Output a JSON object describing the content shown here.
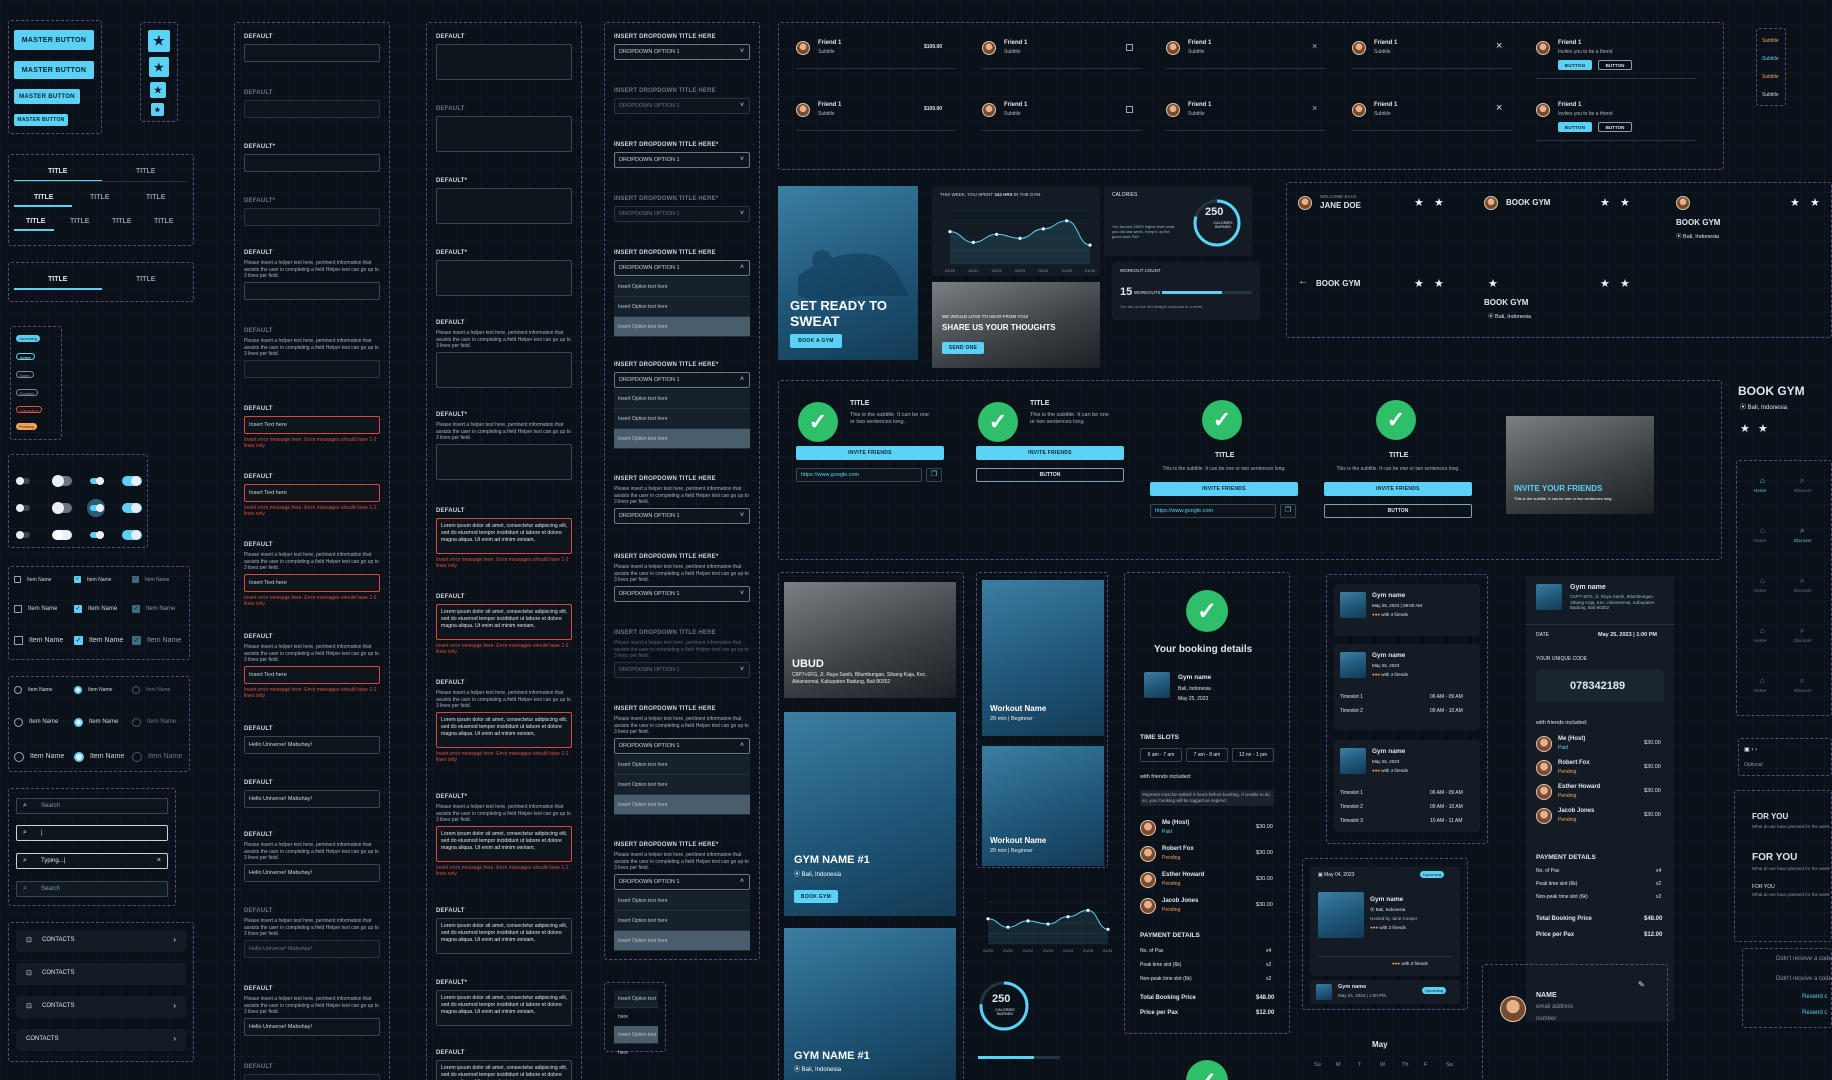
{
  "buttons": {
    "master": "MASTER BUTTON"
  },
  "tabs": {
    "active": "TITLE",
    "inactive": "TITLE"
  },
  "badges": [
    "Upcoming",
    "Active",
    "Done",
    "Expired",
    "Cancelled",
    "Pending"
  ],
  "item_name": "Item Name",
  "search": {
    "placeholder": "Search",
    "typing": "Typing...|",
    "cursor": "|"
  },
  "contacts": "CONTACTS",
  "forms": {
    "default": "DEFAULT",
    "default_req": "DEFAULT*",
    "helper": "Please insert a helper text here, pertinent information that assists the user in completing a field Helper text can go up to 3 lines per field.",
    "insert_text": "Insert Text here",
    "error": "Insert error message here. Error messages should have 1-2 lines only",
    "hello": "Hello Universe! Mabuhay!",
    "lorem": "Lorem ipsum dolor sit amet, consectetur adipiscing elit, sed do eiusmod tempor incididunt ut labore et dolore magna aliqua. Ut enim ad minim veniam,"
  },
  "dropdown": {
    "title": "INSERT DROPDOWN TITLE HERE",
    "title_req": "INSERT DROPDOWN TITLE HERE*",
    "option1": "DROPDOWN OPTION 1",
    "option": "Insert Option text here",
    "helper": "Please insert a helper text here, pertinent information that assists the user in completing a field Helper text can go up to 3 lines per field."
  },
  "friends": {
    "name": "Friend 1",
    "subtitle": "Subtitle",
    "price": "$100.00",
    "invite": "Invites you to be a friend",
    "button": "BUTTON"
  },
  "side_subtitles": [
    "Subtitle",
    "Subtitle",
    "Subtitle",
    "Subtitle"
  ],
  "hero": {
    "line1": "GET READY TO",
    "line2": "SWEAT",
    "cta": "BOOK A GYM"
  },
  "stats": {
    "week_prefix": "THIS WEEK, YOU SPENT",
    "week_value": "342 HRS",
    "week_suffix": "IN THE GYM.",
    "calories_title": "CALORIES",
    "calories_value": "250",
    "calories_label": "CALORIES BURNED",
    "calories_text": "You burned 250% higher than what you did last week. Keep it up the good work Pat!",
    "workout_title": "WORKOUT COUNT",
    "workout_value": "15",
    "workout_unit": "WORKOUTS",
    "workout_text": "You are on the 3rd straight workouts in a week."
  },
  "feedback": {
    "kicker": "WE WOULD LOVE TO HEAR FROM YOU!",
    "title": "SHARE US YOUR THOUGHTS",
    "cta": "SEND ONE"
  },
  "headers": {
    "welcome": "WELCOME BACK",
    "user": "JANE DOE",
    "book_gym": "BOOK GYM",
    "location": "Bali, Indonesia"
  },
  "invite": {
    "title": "TITLE",
    "subtitle": "This is the subtitle. It can be one or two sentences long.",
    "invite_btn": "INVITE FRIENDS",
    "button": "BUTTON",
    "url": "https://www.google.com",
    "photo_title": "INVITE YOUR FRIENDS",
    "photo_sub": "This is the subtitle. It can be one or two sentences long."
  },
  "gyms": {
    "ubud": "UBUD",
    "ubud_addr": "C6P7+5FG, Jl. Raya Sanih, Bilumbungan, Sibang Kaja, Kec. Abiansemal, Kabupaten Badung, Bali 80352",
    "gym1": "GYM NAME #1",
    "location": "Bali, Indonesia",
    "cta": "BOOK GYM",
    "workout_name": "Workout Name",
    "workout_meta": "20 min | Beginner"
  },
  "booking": {
    "title": "Your booking details",
    "gym": "Gym name",
    "location": "Bali, Indonesia",
    "date": "May 25, 2023",
    "time_slots": "TIME SLOTS",
    "slots": [
      "6 am - 7 am",
      "7 am - 8 am",
      "12 nn - 1 pm"
    ],
    "with_friends": "with friends included:",
    "notice": "Payment must be settled 3 hours before booking. If unable to do so, your booking will be tagged as expired.",
    "people": [
      {
        "name": "Me (Host)",
        "status": "Paid",
        "amount": "$30.00"
      },
      {
        "name": "Robert Fox",
        "status": "Pending",
        "amount": "$30.00"
      },
      {
        "name": "Esther Howard",
        "status": "Pending",
        "amount": "$30.00"
      },
      {
        "name": "Jacob Jones",
        "status": "Pending",
        "amount": "$30.00"
      }
    ],
    "payment_details": "PAYMENT DETAILS",
    "pay_rows": [
      {
        "label": "No. of Pax",
        "value": "x4"
      },
      {
        "label": "Peak time slot (6k)",
        "value": "x2"
      },
      {
        "label": "Non-peak time slot (6k)",
        "value": "x2"
      }
    ],
    "total_label": "Total Booking Price",
    "total": "$48.00",
    "pax_label": "Price per Pax",
    "pax": "$12.00"
  },
  "gymlist": {
    "name": "Gym name",
    "date": "May 25, 2023",
    "date_time": "May 25, 2023 | 08:00 AM",
    "friends": "with 3 friends",
    "slot1": "Timeslot 1",
    "slot2": "Timeslot 2",
    "slot3": "Timeslot 3",
    "t1": "06 AM - 09 AM",
    "t2": "09 AM - 10 AM",
    "t3": "10 AM - 11 AM"
  },
  "receipt": {
    "gym": "Gym name",
    "addr": "C6P7+5FG, Jl. Raya Sanih, Bilumbungan, Sibang Kaja, Kec. Abiansemal, Kabupaten Badung, Bali 80352",
    "date_label": "DATE",
    "date_value": "May 25, 2023 | 1:00 PM",
    "code_label": "YOUR UNIQUE CODE",
    "code": "078342189"
  },
  "upcoming": {
    "date": "May 04, 2023",
    "badge": "Upcoming",
    "hosted": "Hosted by Jane Cooper",
    "small_date": "May 04, 2023 | 1:00 PM"
  },
  "profile": {
    "name": "NAME",
    "email": "email address",
    "number": "number"
  },
  "calendar": {
    "month": "May",
    "days": [
      "Su",
      "M",
      "T",
      "W",
      "Th",
      "F",
      "Sa"
    ]
  },
  "right": {
    "book_gym": "BOOK GYM",
    "location": "Bali, Indonesia",
    "home": "Home",
    "discover": "Discover",
    "optional": "Optional",
    "for_you": "FOR YOU",
    "for_you_sub": "What do we have planned for the week",
    "resend1": "Didn't receive a code",
    "resend2": "Resend c"
  },
  "chart_data": {
    "type": "line",
    "x": [
      "01/20",
      "01/21",
      "01/22",
      "01/23",
      "01/24",
      "01/25",
      "01/26"
    ],
    "values": [
      120,
      80,
      110,
      95,
      130,
      160,
      70
    ],
    "ylim": [
      0,
      200
    ]
  }
}
